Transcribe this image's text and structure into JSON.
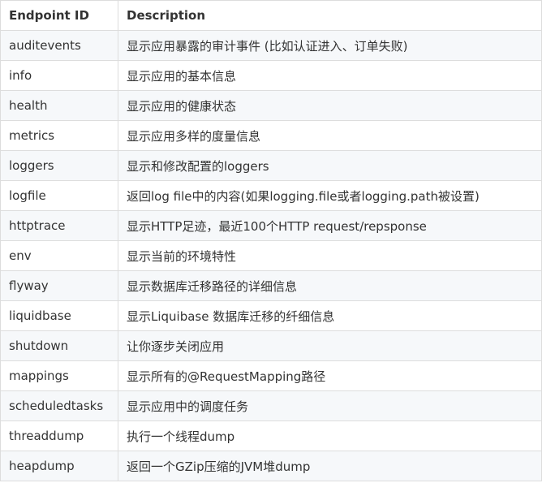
{
  "table": {
    "headers": [
      "Endpoint ID",
      "Description"
    ],
    "rows": [
      {
        "id": "auditevents",
        "desc": "显示应用暴露的审计事件 (比如认证进入、订单失败)"
      },
      {
        "id": "info",
        "desc": "显示应用的基本信息"
      },
      {
        "id": "health",
        "desc": "显示应用的健康状态"
      },
      {
        "id": "metrics",
        "desc": "显示应用多样的度量信息"
      },
      {
        "id": "loggers",
        "desc": "显示和修改配置的loggers"
      },
      {
        "id": "logfile",
        "desc": "返回log file中的内容(如果logging.file或者logging.path被设置)"
      },
      {
        "id": "httptrace",
        "desc": "显示HTTP足迹，最近100个HTTP request/repsponse"
      },
      {
        "id": "env",
        "desc": "显示当前的环境特性"
      },
      {
        "id": "flyway",
        "desc": "显示数据库迁移路径的详细信息"
      },
      {
        "id": "liquidbase",
        "desc": "显示Liquibase 数据库迁移的纤细信息"
      },
      {
        "id": "shutdown",
        "desc": "让你逐步关闭应用"
      },
      {
        "id": "mappings",
        "desc": "显示所有的@RequestMapping路径"
      },
      {
        "id": "scheduledtasks",
        "desc": "显示应用中的调度任务"
      },
      {
        "id": "threaddump",
        "desc": "执行一个线程dump"
      },
      {
        "id": "heapdump",
        "desc": "返回一个GZip压缩的JVM堆dump"
      }
    ]
  }
}
